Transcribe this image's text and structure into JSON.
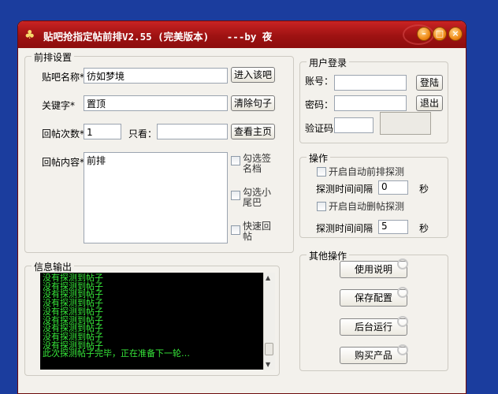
{
  "window": {
    "title": "贴吧抢指定帖前排V2.55 (完美版本)   ---by 夜",
    "controls": {
      "minimize": "–",
      "maximize": "□",
      "close": "×"
    }
  },
  "settings": {
    "group_title": "前排设置",
    "tieba_name_label": "贴吧名称*",
    "tieba_name_value": "彷如梦境",
    "enter_bar_button": "进入该吧",
    "keyword_label": "关键字*",
    "keyword_value": "置顶",
    "clear_button": "清除句子",
    "reply_count_label": "回帖次数*",
    "reply_count_value": "1",
    "only_view_label": "只看：",
    "only_view_value": "",
    "view_home_button": "查看主页",
    "content_label": "回帖内容*",
    "content_value": "前排",
    "options": [
      {
        "label": "勾选签名档",
        "checked": false
      },
      {
        "label": "勾选小尾巴",
        "checked": false
      },
      {
        "label": "快速回帖",
        "checked": false
      }
    ]
  },
  "login": {
    "group_title": "用户登录",
    "account_label": "账号：",
    "account_value": "",
    "login_button": "登陆",
    "password_label": "密码：",
    "password_value": "",
    "logout_button": "退出",
    "captcha_label": "验证码",
    "captcha_value": ""
  },
  "operations": {
    "group_title": "操作",
    "auto_front_label": "开启自动前排探测",
    "auto_front_checked": false,
    "interval1_label": "探测时间间隔",
    "interval1_value": "0",
    "interval1_unit": "秒",
    "auto_delete_label": "开启自动删帖探测",
    "auto_delete_checked": false,
    "interval2_label": "探测时间间隔",
    "interval2_value": "5",
    "interval2_unit": "秒"
  },
  "other": {
    "group_title": "其他操作",
    "buttons": [
      "使用说明",
      "保存配置",
      "后台运行",
      "购买产品"
    ]
  },
  "log": {
    "group_title": "信息输出",
    "lines": [
      "没有探测到帖子",
      "没有探测到帖子",
      "没有探测到帖子",
      "没有探测到帖子",
      "没有探测到帖子",
      "没有探测到帖子",
      "没有探测到帖子",
      "没有探测到帖子",
      "没有探测到帖子",
      "此次探测帖子完毕，正在准备下一轮…"
    ]
  },
  "icons": {
    "app": "bamboo-icon",
    "scroll_up": "▲",
    "scroll_down": "▼"
  },
  "colors": {
    "titlebar": "#b51a1a",
    "log_text": "#37e83a",
    "desktop": "#1b3d9e"
  }
}
